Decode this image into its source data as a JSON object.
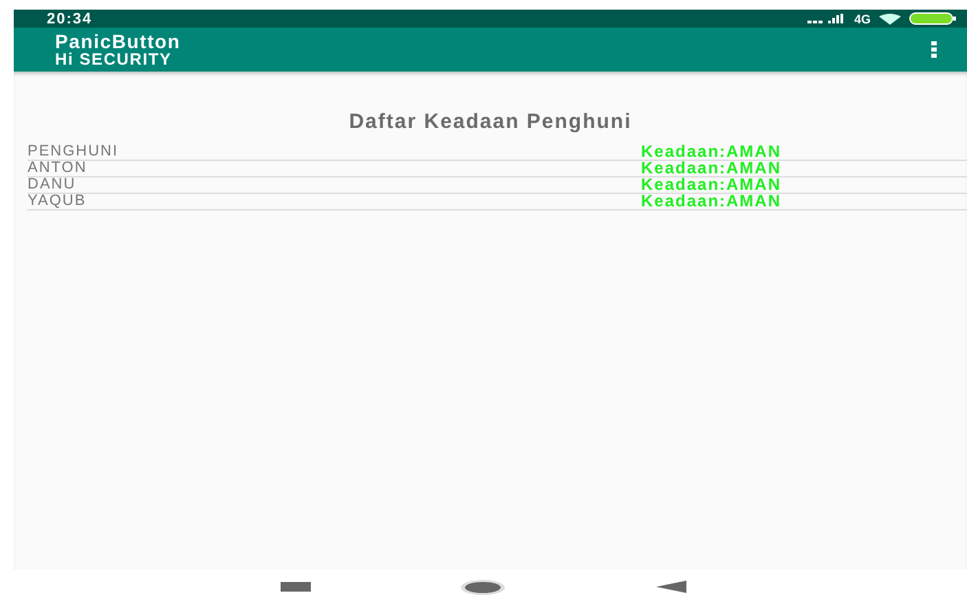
{
  "status_bar": {
    "time": "20:34",
    "network": "4G"
  },
  "app_bar": {
    "title": "PanicButton",
    "subtitle": "Hi SECURITY"
  },
  "heading": "Daftar Keadaan Penghuni",
  "rows": [
    {
      "name": "PENGHUNI",
      "status": "Keadaan:AMAN"
    },
    {
      "name": "ANTON",
      "status": "Keadaan:AMAN"
    },
    {
      "name": "DANU",
      "status": "Keadaan:AMAN"
    },
    {
      "name": "YAQUB",
      "status": "Keadaan:AMAN"
    }
  ]
}
